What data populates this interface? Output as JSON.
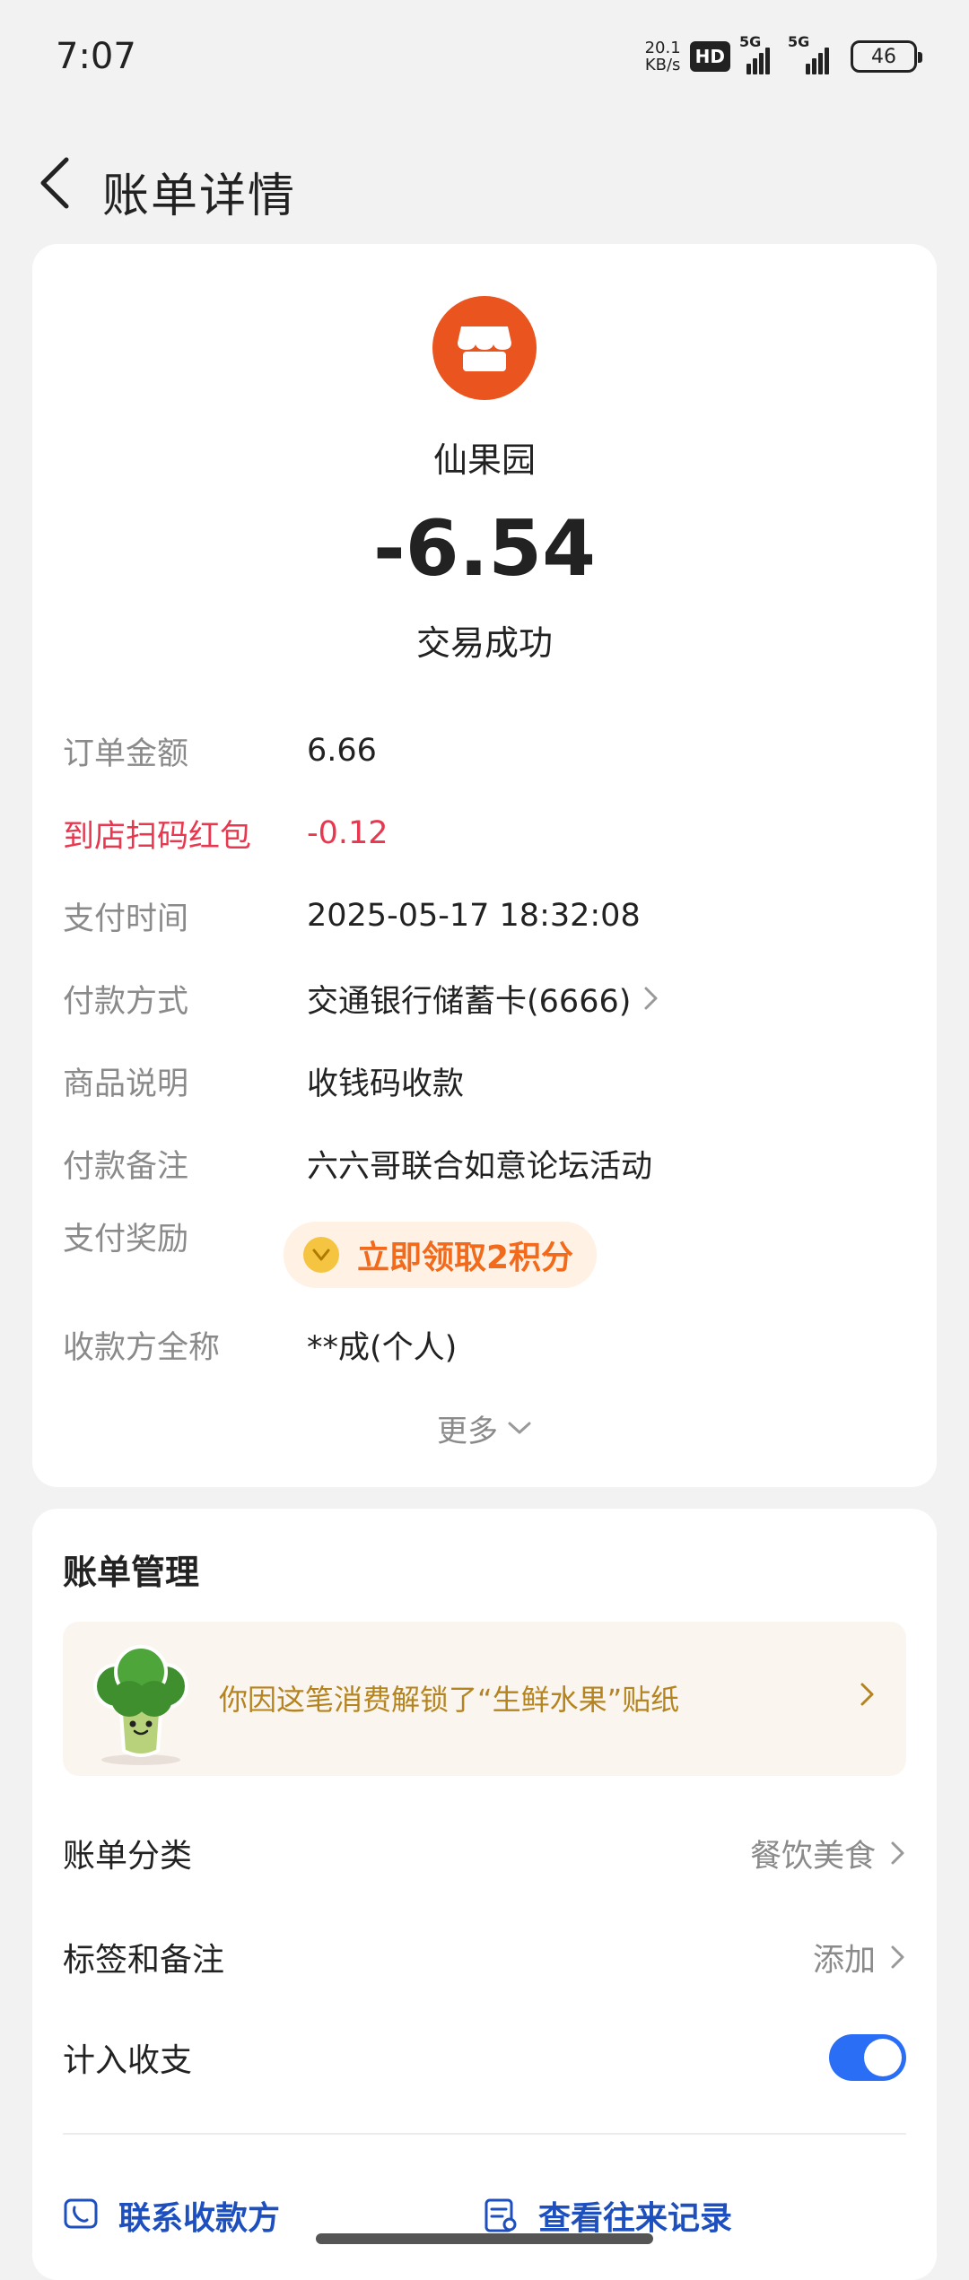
{
  "status_bar": {
    "time": "7:07",
    "net_speed_value": "20.1",
    "net_speed_unit": "KB/s",
    "hd_label": "HD",
    "signal1_label": "5G",
    "signal2_label": "5G",
    "battery": "46"
  },
  "header": {
    "title": "账单详情"
  },
  "transaction": {
    "merchant_name": "仙果园",
    "amount": "-6.54",
    "status": "交易成功"
  },
  "details": [
    {
      "label": "订单金额",
      "value": "6.66"
    },
    {
      "label": "到店扫码红包",
      "value": "-0.12"
    },
    {
      "label": "支付时间",
      "value": "2025-05-17 18:32:08"
    },
    {
      "label": "付款方式",
      "value": "交通银行储蓄卡(6666)"
    },
    {
      "label": "商品说明",
      "value": "收钱码收款"
    },
    {
      "label": "付款备注",
      "value": "六六哥联合如意论坛活动"
    },
    {
      "label": "支付奖励",
      "value": "立即领取2积分"
    },
    {
      "label": "收款方全称",
      "value": "**成(个人)"
    }
  ],
  "more_label": "更多",
  "bill_management": {
    "title": "账单管理",
    "sticker_banner": "你因这笔消费解锁了“生鲜水果”贴纸",
    "category": {
      "label": "账单分类",
      "value": "餐饮美食"
    },
    "tags": {
      "label": "标签和备注",
      "value": "添加"
    },
    "include": {
      "label": "计入收支",
      "enabled": true
    },
    "actions": [
      {
        "label": "联系收款方"
      },
      {
        "label": "查看往来记录"
      }
    ]
  },
  "colors": {
    "merchant_icon": "#e9541f",
    "negative_red": "#e8384f",
    "reward_orange": "#f26a1b",
    "toggle_blue": "#2b6ef6",
    "action_blue": "#1d4fbf",
    "sticker_gold": "#b48420"
  },
  "icons": {
    "back": "back-arrow-icon",
    "merchant": "shop-icon",
    "reward": "coin-icon",
    "more": "chevron-down-icon",
    "contact": "phone-chat-icon",
    "records": "document-list-icon"
  }
}
